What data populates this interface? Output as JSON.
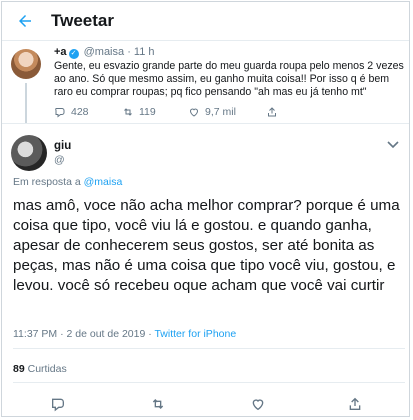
{
  "header": {
    "title": "Tweetar"
  },
  "parent_tweet": {
    "name": "+a",
    "handle": "@maisa",
    "time": "11 h",
    "text": "Gente, eu esvazio grande parte do meu guarda roupa pelo menos 2 vezes ao ano. Só que mesmo assim, eu ganho muita coisa!! Por isso q é bem raro eu comprar roupas; pq fico pensando \"ah mas eu já tenho mt\"",
    "replies": "428",
    "retweets": "119",
    "likes": "9,7 mil"
  },
  "main_tweet": {
    "name": "giu",
    "handle": "@",
    "reply_prefix": "Em resposta a",
    "reply_mention": "@maisa",
    "text": "mas amô, voce não acha melhor comprar? porque é uma coisa que tipo, você viu lá e gostou. e quando ganha, apesar de conhecerem seus gostos, ser até bonita as peças, mas não é uma coisa que tipo você viu, gostou, e levou. você só recebeu oque acham que você vai curtir",
    "timestamp": "11:37 PM · 2 de out de 2019 ·",
    "source": "Twitter for iPhone",
    "like_count": "89",
    "like_label": "Curtidas"
  },
  "colors": {
    "accent": "#1da1f2",
    "muted": "#657786",
    "text": "#14171a"
  },
  "icons": {
    "back": "arrow-left-icon",
    "reply": "reply-icon",
    "retweet": "retweet-icon",
    "like": "heart-icon",
    "share": "share-icon",
    "more": "chevron-down-icon"
  }
}
